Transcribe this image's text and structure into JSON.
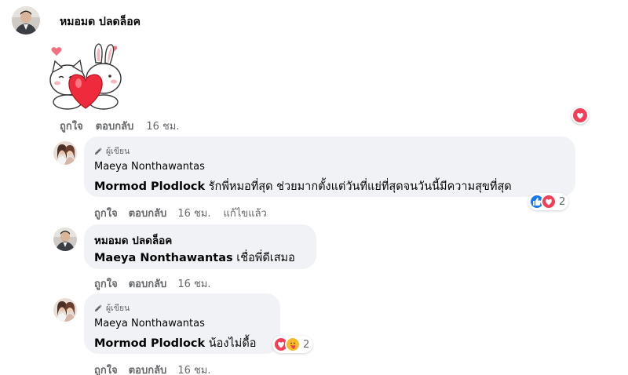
{
  "comment": {
    "author": "หมอมด ปลดล็อค",
    "sticker": "bunny-cat-heart-sticker",
    "like_label": "ถูกใจ",
    "reply_label": "ตอบกลับ",
    "time": "16 ชม.",
    "reaction": "heart"
  },
  "replies": [
    {
      "author_badge": "ผู้เขียน",
      "author": "Maeya Nonthawantas",
      "mention": "Mormod Plodlock",
      "text": "รักพี่หมอที่สุด ช่วยมากตั้งแต่วันที่แย่ที่สุดจนวันนี้มีความสุขที่สุด",
      "like_label": "ถูกใจ",
      "reply_label": "ตอบกลับ",
      "time": "16 ชม.",
      "edited_label": "แก้ไขแล้ว",
      "reactions": [
        "like",
        "heart"
      ],
      "reaction_count": "2"
    },
    {
      "author": "หมอมด ปลดล็อค",
      "mention": "Maeya Nonthawantas",
      "text": "เชื่อพี่ดีเสมอ",
      "like_label": "ถูกใจ",
      "reply_label": "ตอบกลับ",
      "time": "16 ชม."
    },
    {
      "author_badge": "ผู้เขียน",
      "author": "Maeya Nonthawantas",
      "mention": "Mormod Plodlock",
      "text": "น้องไม่ดื้อ",
      "like_label": "ถูกใจ",
      "reply_label": "ตอบกลับ",
      "time": "16 ชม.",
      "reactions": [
        "heart",
        "care"
      ],
      "reaction_count": "2"
    }
  ],
  "colors": {
    "bubble": "#f0f2f5",
    "meta": "#65676b",
    "like_blue": "#1877f2",
    "heart_red": "#f33e58",
    "care_yellow": "#f7b928"
  }
}
